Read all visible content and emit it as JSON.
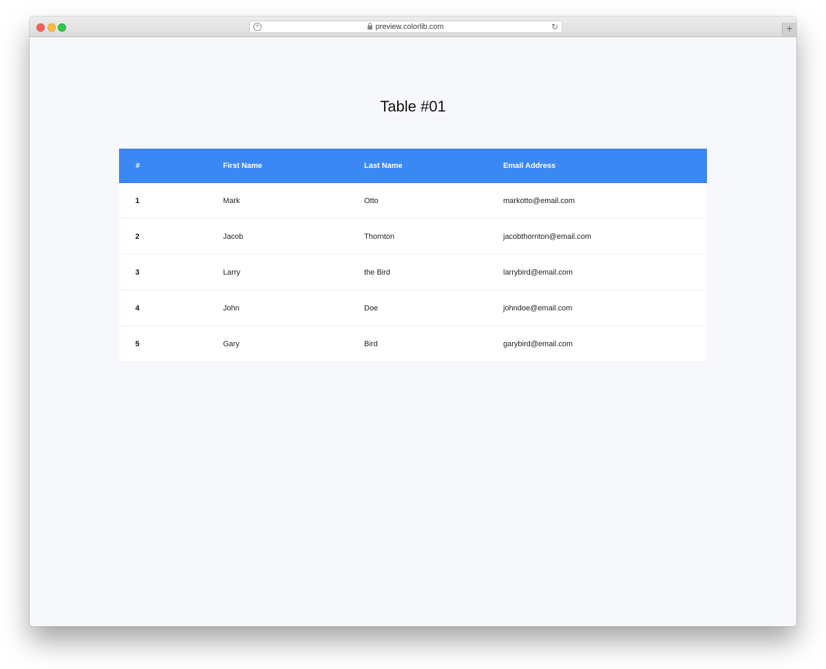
{
  "browser": {
    "url": "preview.colorlib.com"
  },
  "page": {
    "title": "Table #01"
  },
  "table": {
    "headers": [
      "#",
      "First Name",
      "Last Name",
      "Email Address"
    ],
    "rows": [
      [
        "1",
        "Mark",
        "Otto",
        "markotto@email.com"
      ],
      [
        "2",
        "Jacob",
        "Thornton",
        "jacobthornton@email.com"
      ],
      [
        "3",
        "Larry",
        "the Bird",
        "larrybird@email.com"
      ],
      [
        "4",
        "John",
        "Doe",
        "johndoe@email.com"
      ],
      [
        "5",
        "Gary",
        "Bird",
        "garybird@email.com"
      ]
    ]
  },
  "colors": {
    "header_bg": "#3b88f5",
    "page_bg": "#f7f8fc"
  }
}
